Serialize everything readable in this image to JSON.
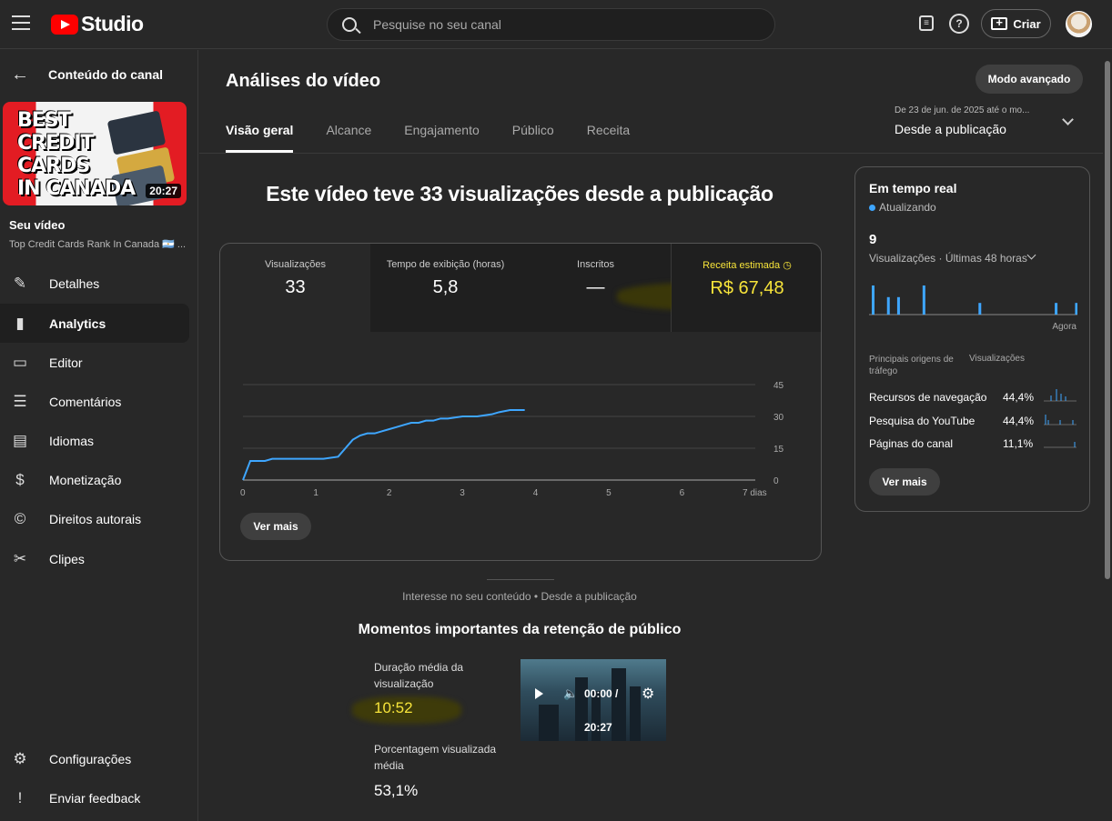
{
  "app": {
    "logo_text": "Studio"
  },
  "search": {
    "placeholder": "Pesquise no seu canal"
  },
  "topbar": {
    "create_label": "Criar"
  },
  "sidebar": {
    "back_title": "Conteúdo do canal",
    "thumbnail": {
      "lines": [
        "BEST",
        "CREDIT",
        "CARDS",
        "IN CANADA"
      ],
      "duration": "20:27"
    },
    "your_video_label": "Seu vídeo",
    "video_title": "Top Credit Cards Rank In Canada 🇦🇷 ...",
    "items": [
      {
        "label": "Detalhes",
        "icon": "pencil-icon"
      },
      {
        "label": "Analytics",
        "icon": "analytics-icon"
      },
      {
        "label": "Editor",
        "icon": "clapper-icon"
      },
      {
        "label": "Comentários",
        "icon": "comment-icon"
      },
      {
        "label": "Idiomas",
        "icon": "subtitles-icon"
      },
      {
        "label": "Monetização",
        "icon": "dollar-icon"
      },
      {
        "label": "Direitos autorais",
        "icon": "copyright-icon"
      },
      {
        "label": "Clipes",
        "icon": "scissors-icon"
      }
    ],
    "bottom_items": [
      {
        "label": "Configurações",
        "icon": "gear-icon"
      },
      {
        "label": "Enviar feedback",
        "icon": "feedback-icon"
      }
    ]
  },
  "main": {
    "title": "Análises do vídeo",
    "advanced_button": "Modo avançado",
    "tabs": [
      "Visão geral",
      "Alcance",
      "Engajamento",
      "Público",
      "Receita"
    ],
    "date_range": {
      "line1": "De 23 de jun. de 2025 até o mo...",
      "line2": "Desde a publicação"
    },
    "headline": "Este vídeo teve 33 visualizações desde a publicação",
    "metrics": [
      {
        "label": "Visualizações",
        "value": "33"
      },
      {
        "label": "Tempo de exibição (horas)",
        "value": "5,8"
      },
      {
        "label": "Inscritos",
        "value": "—"
      },
      {
        "label": "Receita estimada",
        "value": "R$ 67,48"
      }
    ],
    "ver_mais": "Ver mais",
    "interest_text": "Interesse no seu conteúdo • Desde a publicação",
    "moments_title": "Momentos importantes da retenção de público",
    "avg_duration_label": "Duração média da visualização",
    "avg_duration_value": "10:52",
    "avg_percent_label": "Porcentagem visualizada média",
    "avg_percent_value": "53,1%",
    "player": {
      "time": "00:00 /",
      "duration": "20:27"
    }
  },
  "chart_data": {
    "type": "line",
    "x_ticks": [
      "0",
      "1",
      "2",
      "3",
      "4",
      "5",
      "6",
      "7 dias"
    ],
    "y_ticks": [
      "0",
      "15",
      "30",
      "45"
    ],
    "ylim": [
      0,
      45
    ],
    "xlim": [
      0,
      7
    ],
    "series": [
      {
        "color": "#3ea6ff",
        "points": [
          [
            0,
            0
          ],
          [
            0.1,
            9
          ],
          [
            0.3,
            9
          ],
          [
            0.4,
            10
          ],
          [
            0.6,
            10
          ],
          [
            1.1,
            10
          ],
          [
            1.3,
            11
          ],
          [
            1.4,
            15
          ],
          [
            1.5,
            19
          ],
          [
            1.6,
            21
          ],
          [
            1.7,
            22
          ],
          [
            1.8,
            22
          ],
          [
            1.9,
            23
          ],
          [
            2.0,
            24
          ],
          [
            2.1,
            25
          ],
          [
            2.2,
            26
          ],
          [
            2.3,
            27
          ],
          [
            2.4,
            27
          ],
          [
            2.5,
            28
          ],
          [
            2.6,
            28
          ],
          [
            2.7,
            29
          ],
          [
            2.8,
            29
          ],
          [
            3.0,
            30
          ],
          [
            3.2,
            30
          ],
          [
            3.4,
            31
          ],
          [
            3.5,
            32
          ],
          [
            3.65,
            33
          ],
          [
            3.85,
            33
          ]
        ]
      }
    ]
  },
  "realtime": {
    "title": "Em tempo real",
    "status": "Atualizando",
    "count": "9",
    "subtitle": "Visualizações · Últimas 48 horas",
    "now_label": "Agora",
    "bars": [
      5,
      0,
      0,
      3,
      0,
      3,
      0,
      0,
      0,
      0,
      5,
      0,
      0,
      0,
      0,
      0,
      0,
      0,
      0,
      0,
      0,
      2,
      0,
      0,
      0,
      0,
      0,
      0,
      0,
      0,
      0,
      0,
      0,
      0,
      0,
      0,
      2,
      0,
      0,
      0,
      2
    ],
    "sources_header_1": "Principais origens de tráfego",
    "sources_header_2": "Visualizações",
    "sources": [
      {
        "name": "Recursos de navegação",
        "pct": "44,4%"
      },
      {
        "name": "Pesquisa do YouTube",
        "pct": "44,4%"
      },
      {
        "name": "Páginas do canal",
        "pct": "11,1%"
      }
    ],
    "ver_mais": "Ver mais"
  },
  "colors": {
    "accent": "#3ea6ff",
    "revenue": "#f7e43a",
    "brand": "#ff0000"
  }
}
